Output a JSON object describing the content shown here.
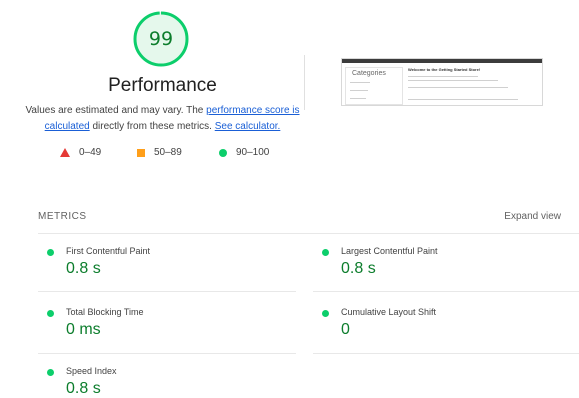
{
  "performance": {
    "score": "99",
    "title": "Performance",
    "desc_prefix": "Values are estimated and may vary. The ",
    "desc_link1": "performance score is calculated",
    "desc_middle": " directly from these metrics. ",
    "desc_link2": "See calculator.",
    "score_fraction": 0.99,
    "gauge_color": "#0cce6b"
  },
  "legend": [
    {
      "icon": "triangle-icon",
      "label": "0–49",
      "color": "#e53935"
    },
    {
      "icon": "square-icon",
      "label": "50–89",
      "color": "#ff9f1a"
    },
    {
      "icon": "circle-icon",
      "label": "90–100",
      "color": "#0cce6b"
    }
  ],
  "thumbnail": {
    "categories_label": "Categories",
    "welcome_text": "Welcome to the Getting Started Store!"
  },
  "metrics": {
    "header": "METRICS",
    "expand_label": "Expand view",
    "items": [
      {
        "name": "First Contentful Paint",
        "value": "0.8 s"
      },
      {
        "name": "Largest Contentful Paint",
        "value": "0.8 s"
      },
      {
        "name": "Total Blocking Time",
        "value": "0 ms"
      },
      {
        "name": "Cumulative Layout Shift",
        "value": "0"
      },
      {
        "name": "Speed Index",
        "value": "0.8 s"
      }
    ]
  }
}
